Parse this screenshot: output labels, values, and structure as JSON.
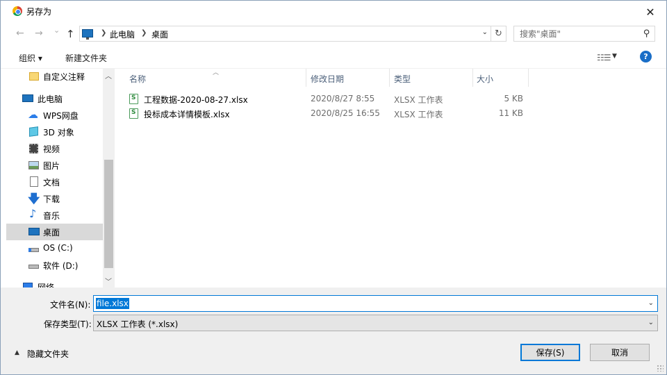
{
  "window": {
    "title": "另存为",
    "close_glyph": "✕"
  },
  "nav": {
    "back_glyph": "←",
    "forward_glyph": "→",
    "recent_glyph": "⌄",
    "up_glyph": "↑",
    "breadcrumbs": [
      "此电脑",
      "桌面"
    ],
    "search_placeholder": "搜索\"桌面\""
  },
  "toolbar": {
    "organize_label": "组织 ▾",
    "new_folder_label": "新建文件夹",
    "help_label": "?"
  },
  "sidebar": {
    "items": [
      {
        "label": "自定义注释",
        "icon": "folder-icon"
      },
      {
        "label": "此电脑",
        "icon": "computer-icon"
      },
      {
        "label": "WPS网盘",
        "icon": "cloud-icon"
      },
      {
        "label": "3D 对象",
        "icon": "3d-objects-icon"
      },
      {
        "label": "视频",
        "icon": "video-icon"
      },
      {
        "label": "图片",
        "icon": "pictures-icon"
      },
      {
        "label": "文档",
        "icon": "documents-icon"
      },
      {
        "label": "下载",
        "icon": "download-icon"
      },
      {
        "label": "音乐",
        "icon": "music-icon"
      },
      {
        "label": "桌面",
        "icon": "desktop-icon",
        "selected": true
      },
      {
        "label": "OS (C:)",
        "icon": "drive-c-icon"
      },
      {
        "label": "软件 (D:)",
        "icon": "drive-d-icon"
      },
      {
        "label": "网络",
        "icon": "network-icon"
      }
    ]
  },
  "filelist": {
    "columns": [
      "名称",
      "修改日期",
      "类型",
      "大小"
    ],
    "rows": [
      {
        "name": "工程数据-2020-08-27.xlsx",
        "date": "2020/8/27 8:55",
        "type": "XLSX 工作表",
        "size": "5 KB"
      },
      {
        "name": "投标成本详情模板.xlsx",
        "date": "2020/8/25 16:55",
        "type": "XLSX 工作表",
        "size": "11 KB"
      }
    ]
  },
  "bottom": {
    "filename_label": "文件名(N):",
    "filename_value": "file.xlsx",
    "filetype_label": "保存类型(T):",
    "filetype_value": "XLSX 工作表 (*.xlsx)",
    "hide_folders_label": "隐藏文件夹",
    "save_label": "保存(S)",
    "cancel_label": "取消"
  },
  "colors": {
    "accent": "#0078d7",
    "selected_bg": "#d9d9d9",
    "header_text": "#4c607a"
  }
}
